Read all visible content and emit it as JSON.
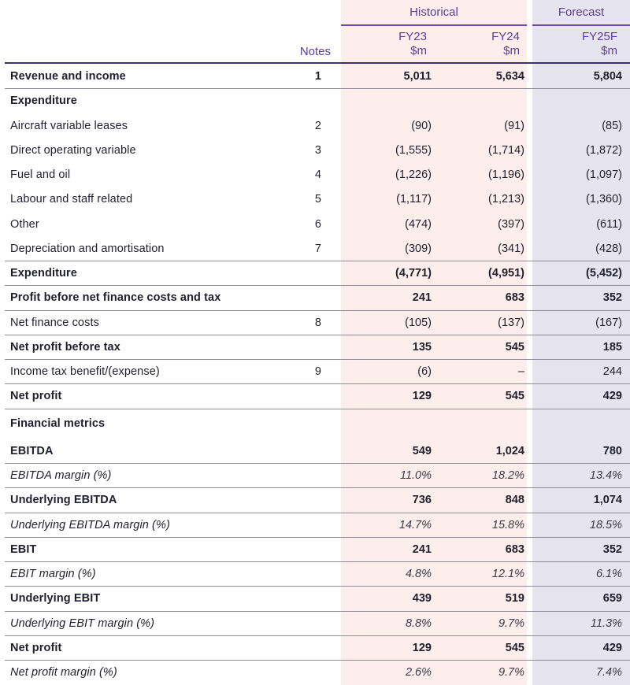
{
  "header": {
    "historical": "Historical",
    "forecast": "Forecast",
    "notes": "Notes",
    "columns": [
      {
        "year": "FY23",
        "unit": "$m"
      },
      {
        "year": "FY24",
        "unit": "$m"
      },
      {
        "year": "FY25F",
        "unit": "$m"
      }
    ]
  },
  "rows": [
    {
      "label": "Revenue and income",
      "note": "1",
      "v": [
        "5,011",
        "5,634",
        "5,804"
      ]
    },
    {
      "label": "Expenditure",
      "note": "",
      "v": [
        "",
        "",
        ""
      ]
    },
    {
      "label": "Aircraft variable leases",
      "note": "2",
      "v": [
        "(90)",
        "(91)",
        "(85)"
      ]
    },
    {
      "label": "Direct operating variable",
      "note": "3",
      "v": [
        "(1,555)",
        "(1,714)",
        "(1,872)"
      ]
    },
    {
      "label": "Fuel and oil",
      "note": "4",
      "v": [
        "(1,226)",
        "(1,196)",
        "(1,097)"
      ]
    },
    {
      "label": "Labour and staff related",
      "note": "5",
      "v": [
        "(1,117)",
        "(1,213)",
        "(1,360)"
      ]
    },
    {
      "label": "Other",
      "note": "6",
      "v": [
        "(474)",
        "(397)",
        "(611)"
      ]
    },
    {
      "label": "Depreciation and amortisation",
      "note": "7",
      "v": [
        "(309)",
        "(341)",
        "(428)"
      ]
    },
    {
      "label": "Expenditure",
      "note": "",
      "v": [
        "(4,771)",
        "(4,951)",
        "(5,452)"
      ]
    },
    {
      "label": "Profit before net finance costs and tax",
      "note": "",
      "v": [
        "241",
        "683",
        "352"
      ]
    },
    {
      "label": "Net finance costs",
      "note": "8",
      "v": [
        "(105)",
        "(137)",
        "(167)"
      ]
    },
    {
      "label": "Net profit before tax",
      "note": "",
      "v": [
        "135",
        "545",
        "185"
      ]
    },
    {
      "label": "Income tax benefit/(expense)",
      "note": "9",
      "v": [
        "(6)",
        "–",
        "244"
      ]
    },
    {
      "label": "Net profit",
      "note": "",
      "v": [
        "129",
        "545",
        "429"
      ]
    },
    {
      "label": "Financial metrics",
      "note": "",
      "v": [
        "",
        "",
        ""
      ]
    },
    {
      "label": "EBITDA",
      "note": "",
      "v": [
        "549",
        "1,024",
        "780"
      ]
    },
    {
      "label": "EBITDA margin (%)",
      "note": "",
      "v": [
        "11.0%",
        "18.2%",
        "13.4%"
      ]
    },
    {
      "label": "Underlying EBITDA",
      "note": "",
      "v": [
        "736",
        "848",
        "1,074"
      ]
    },
    {
      "label": "Underlying EBITDA margin (%)",
      "note": "",
      "v": [
        "14.7%",
        "15.8%",
        "18.5%"
      ]
    },
    {
      "label": "EBIT",
      "note": "",
      "v": [
        "241",
        "683",
        "352"
      ]
    },
    {
      "label": "EBIT margin (%)",
      "note": "",
      "v": [
        "4.8%",
        "12.1%",
        "6.1%"
      ]
    },
    {
      "label": "Underlying EBIT",
      "note": "",
      "v": [
        "439",
        "519",
        "659"
      ]
    },
    {
      "label": "Underlying EBIT margin (%)",
      "note": "",
      "v": [
        "8.8%",
        "9.7%",
        "11.3%"
      ]
    },
    {
      "label": "Net profit",
      "note": "",
      "v": [
        "129",
        "545",
        "429"
      ]
    },
    {
      "label": "Net profit margin (%)",
      "note": "",
      "v": [
        "2.6%",
        "9.7%",
        "7.4%"
      ]
    }
  ]
}
